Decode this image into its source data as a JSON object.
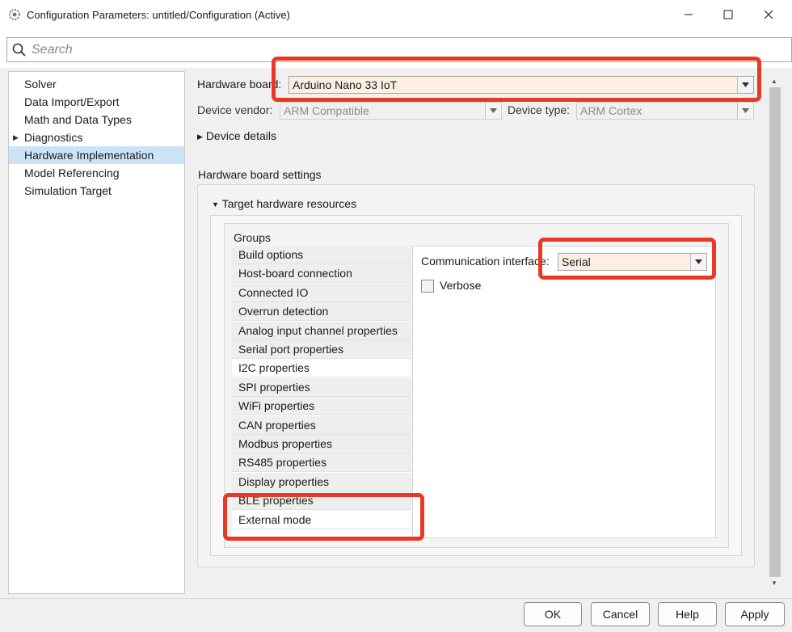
{
  "window": {
    "title": "Configuration Parameters: untitled/Configuration (Active)",
    "controls": [
      "minimize-icon",
      "maximize-icon",
      "close-icon"
    ]
  },
  "search": {
    "placeholder": "Search",
    "value": ""
  },
  "sidebar": {
    "items": [
      {
        "label": "Solver",
        "selected": false,
        "expandable": false
      },
      {
        "label": "Data Import/Export",
        "selected": false,
        "expandable": false
      },
      {
        "label": "Math and Data Types",
        "selected": false,
        "expandable": false
      },
      {
        "label": "Diagnostics",
        "selected": false,
        "expandable": true
      },
      {
        "label": "Hardware Implementation",
        "selected": true,
        "expandable": false
      },
      {
        "label": "Model Referencing",
        "selected": false,
        "expandable": false
      },
      {
        "label": "Simulation Target",
        "selected": false,
        "expandable": false
      }
    ]
  },
  "hardware": {
    "board_label": "Hardware board:",
    "board_value": "Arduino Nano 33 IoT",
    "vendor_label": "Device vendor:",
    "vendor_value": "ARM Compatible",
    "type_label": "Device type:",
    "type_value": "ARM Cortex",
    "device_details": "Device details",
    "board_settings": "Hardware board settings",
    "target_resources": "Target hardware resources",
    "groups_label": "Groups"
  },
  "groups": [
    {
      "label": "Build options",
      "active": false
    },
    {
      "label": "Host-board connection",
      "active": false
    },
    {
      "label": "Connected IO",
      "active": false
    },
    {
      "label": "Overrun detection",
      "active": false
    },
    {
      "label": "Analog input channel properties",
      "active": false
    },
    {
      "label": "Serial port properties",
      "active": false
    },
    {
      "label": "I2C properties",
      "active": true
    },
    {
      "label": "SPI properties",
      "active": false
    },
    {
      "label": "WiFi properties",
      "active": false
    },
    {
      "label": "CAN properties",
      "active": false
    },
    {
      "label": "Modbus properties",
      "active": false
    },
    {
      "label": "RS485 properties",
      "active": false
    },
    {
      "label": "Display properties",
      "active": false
    },
    {
      "label": "BLE properties",
      "active": false
    },
    {
      "label": "External mode",
      "active": true
    }
  ],
  "external_mode": {
    "comm_label": "Communication interface:",
    "comm_value": "Serial",
    "verbose_label": "Verbose",
    "verbose_checked": false
  },
  "buttons": {
    "ok": "OK",
    "cancel": "Cancel",
    "help": "Help",
    "apply": "Apply"
  },
  "colors": {
    "highlight": "#e63a26",
    "selection": "#cce4f7",
    "board_field": "#fdf0e3"
  }
}
